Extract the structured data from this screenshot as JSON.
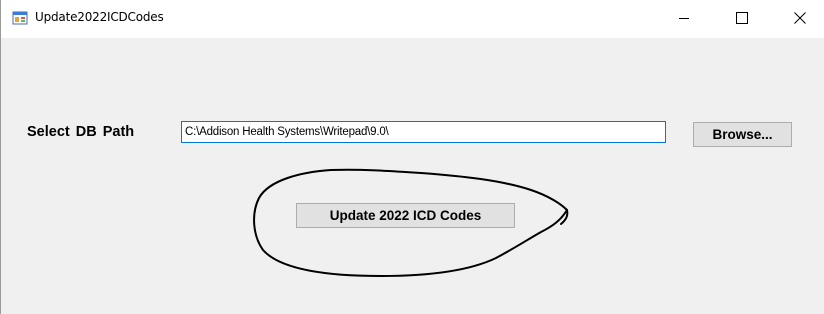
{
  "window": {
    "title": "Update2022ICDCodes",
    "icons": {
      "app": "winforms-app-icon",
      "minimize": "minimize-icon",
      "maximize": "maximize-icon",
      "close": "close-icon"
    }
  },
  "form": {
    "db_path_label": "Select  DB Path",
    "db_path_value": "C:\\Addison Health Systems\\Writepad\\9.0\\",
    "browse_label": "Browse...",
    "update_label": "Update 2022 ICD Codes"
  },
  "colors": {
    "titlebar": "#ffffff",
    "client": "#f0f0f0",
    "button": "#e1e1e1",
    "input_focus_border": "#0078d7",
    "annotation": "#000000"
  }
}
